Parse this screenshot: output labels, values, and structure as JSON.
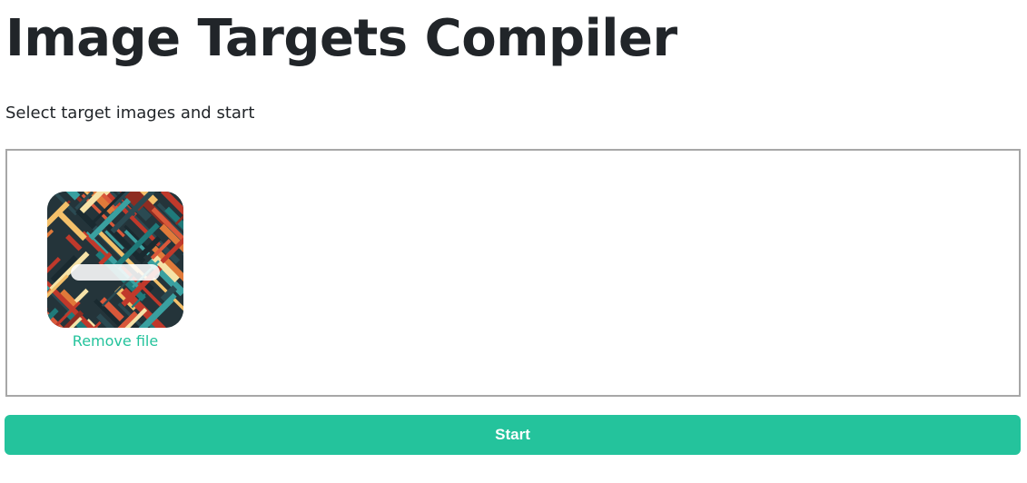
{
  "page": {
    "title": "Image Targets Compiler",
    "subtitle": "Select target images and start"
  },
  "dropzone": {
    "files": [
      {
        "remove_label": "Remove file",
        "thumbnail_icon": "abstract-pattern-image"
      }
    ]
  },
  "actions": {
    "start_label": "Start"
  },
  "colors": {
    "accent": "#24c39c",
    "text": "#212529",
    "border": "#a7a7a7"
  }
}
